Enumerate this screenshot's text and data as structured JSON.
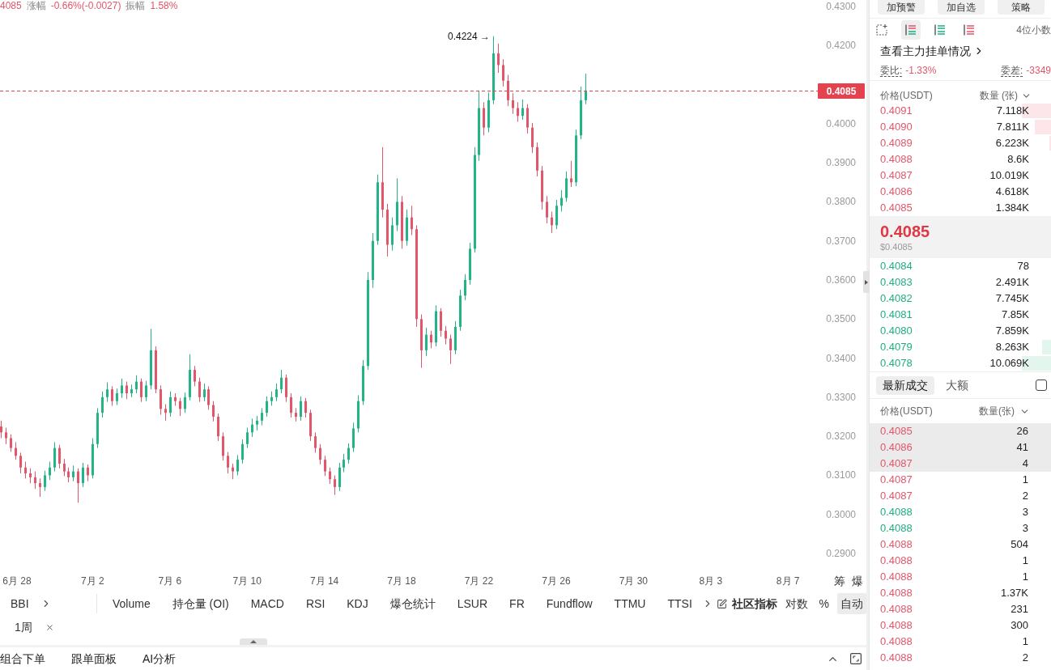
{
  "chart_header": {
    "last_price": "4085",
    "change_label": "涨幅",
    "change": "-0.66%(-0.0027)",
    "amplitude_label": "振幅",
    "amplitude": "1.58%"
  },
  "chart": {
    "chart_data": [
      {
        "type": "candlestick",
        "xlim": [
          "--06-27T05:00",
          "--08-08T13:00"
        ],
        "ylim": [
          0.29,
          0.43
        ],
        "xticks": [
          {
            "value": "--06-28",
            "label": "6月 28"
          },
          {
            "value": "--07-02",
            "label": "7月 2"
          },
          {
            "value": "--07-06",
            "label": "7月 6"
          },
          {
            "value": "--07-10",
            "label": "7月 10"
          },
          {
            "value": "--07-14",
            "label": "7月 14"
          },
          {
            "value": "--07-18",
            "label": "7月 18"
          },
          {
            "value": "--07-22",
            "label": "7月 22"
          },
          {
            "value": "--07-26",
            "label": "7月 26"
          },
          {
            "value": "--07-30",
            "label": "7月 30"
          },
          {
            "value": "--08-03",
            "label": "8月 3"
          },
          {
            "value": "--08-07",
            "label": "8月 7"
          }
        ],
        "yticks": [
          {
            "value": 0.43,
            "label": "0.4300"
          },
          {
            "value": 0.42,
            "label": "0.4200"
          },
          {
            "value": 0.4,
            "label": "0.4000"
          },
          {
            "value": 0.39,
            "label": "0.3900"
          },
          {
            "value": 0.38,
            "label": "0.3800"
          },
          {
            "value": 0.37,
            "label": "0.3700"
          },
          {
            "value": 0.36,
            "label": "0.3600"
          },
          {
            "value": 0.35,
            "label": "0.3500"
          },
          {
            "value": 0.34,
            "label": "0.3400"
          },
          {
            "value": 0.33,
            "label": "0.3300"
          },
          {
            "value": 0.32,
            "label": "0.3200"
          },
          {
            "value": 0.31,
            "label": "0.3100"
          },
          {
            "value": 0.3,
            "label": "0.3000"
          },
          {
            "value": 0.29,
            "label": "0.2900"
          }
        ],
        "ref_lines": [
          {
            "axis": "y",
            "value": 0.4085,
            "label": "0.4085",
            "color": "#e5424f",
            "line_style": "dashed"
          }
        ],
        "annotations": [
          "0.4224 →"
        ],
        "x": [
          "--06-27T06:00",
          "--06-27T12:00",
          "--06-27T18:00",
          "--06-28T00:00",
          "--06-28T06:00",
          "--06-28T12:00",
          "--06-28T18:00",
          "--06-29T00:00",
          "--06-29T06:00",
          "--06-29T12:00",
          "--06-29T18:00",
          "--06-30T00:00",
          "--06-30T06:00",
          "--06-30T12:00",
          "--06-30T18:00",
          "--07-01T00:00",
          "--07-01T06:00",
          "--07-01T12:00",
          "--07-01T18:00",
          "--07-02T00:00",
          "--07-02T06:00",
          "--07-02T12:00",
          "--07-02T18:00",
          "--07-03T00:00",
          "--07-03T06:00",
          "--07-03T12:00",
          "--07-03T18:00",
          "--07-04T00:00",
          "--07-04T06:00",
          "--07-04T12:00",
          "--07-04T18:00",
          "--07-05T00:00",
          "--07-05T06:00",
          "--07-05T12:00",
          "--07-05T18:00",
          "--07-06T00:00",
          "--07-06T06:00",
          "--07-06T12:00",
          "--07-06T18:00",
          "--07-07T00:00",
          "--07-07T06:00",
          "--07-07T12:00",
          "--07-07T18:00",
          "--07-08T00:00",
          "--07-08T06:00",
          "--07-08T12:00",
          "--07-08T18:00",
          "--07-09T00:00",
          "--07-09T06:00",
          "--07-09T12:00",
          "--07-09T18:00",
          "--07-10T00:00",
          "--07-10T06:00",
          "--07-10T12:00",
          "--07-10T18:00",
          "--07-11T00:00",
          "--07-11T06:00",
          "--07-11T12:00",
          "--07-11T18:00",
          "--07-12T00:00",
          "--07-12T06:00",
          "--07-12T12:00",
          "--07-12T18:00",
          "--07-13T00:00",
          "--07-13T06:00",
          "--07-13T12:00",
          "--07-13T18:00",
          "--07-14T00:00",
          "--07-14T06:00",
          "--07-14T12:00",
          "--07-14T18:00",
          "--07-15T00:00",
          "--07-15T06:00",
          "--07-15T12:00",
          "--07-15T18:00",
          "--07-16T00:00",
          "--07-16T06:00",
          "--07-16T12:00",
          "--07-16T18:00",
          "--07-17T00:00",
          "--07-17T06:00",
          "--07-17T12:00",
          "--07-17T18:00",
          "--07-18T00:00",
          "--07-18T06:00",
          "--07-18T12:00",
          "--07-18T18:00",
          "--07-19T00:00",
          "--07-19T06:00",
          "--07-19T12:00",
          "--07-19T18:00",
          "--07-20T00:00",
          "--07-20T06:00",
          "--07-20T12:00",
          "--07-20T18:00",
          "--07-21T00:00",
          "--07-21T06:00",
          "--07-21T12:00",
          "--07-21T18:00",
          "--07-22T00:00",
          "--07-22T06:00",
          "--07-22T12:00",
          "--07-22T18:00",
          "--07-23T00:00",
          "--07-23T06:00",
          "--07-23T12:00",
          "--07-23T18:00",
          "--07-24T00:00",
          "--07-24T06:00",
          "--07-24T12:00",
          "--07-24T18:00",
          "--07-25T00:00",
          "--07-25T06:00",
          "--07-25T12:00",
          "--07-25T18:00",
          "--07-26T00:00",
          "--07-26T06:00",
          "--07-26T12:00",
          "--07-26T18:00",
          "--07-27T00:00",
          "--07-27T06:00",
          "--07-27T12:00"
        ],
        "ohlc": [
          [
            0.3225,
            0.324,
            0.3195,
            0.321
          ],
          [
            0.321,
            0.3222,
            0.318,
            0.3195
          ],
          [
            0.3195,
            0.3205,
            0.316,
            0.317
          ],
          [
            0.317,
            0.3185,
            0.314,
            0.315
          ],
          [
            0.315,
            0.3158,
            0.3105,
            0.312
          ],
          [
            0.312,
            0.3135,
            0.3092,
            0.3105
          ],
          [
            0.3105,
            0.3118,
            0.308,
            0.3095
          ],
          [
            0.3095,
            0.311,
            0.3065,
            0.308
          ],
          [
            0.308,
            0.3092,
            0.3045,
            0.307
          ],
          [
            0.307,
            0.3112,
            0.306,
            0.31
          ],
          [
            0.31,
            0.3135,
            0.3088,
            0.312
          ],
          [
            0.312,
            0.3185,
            0.311,
            0.317
          ],
          [
            0.317,
            0.3178,
            0.3118,
            0.313
          ],
          [
            0.313,
            0.3142,
            0.3098,
            0.311
          ],
          [
            0.311,
            0.312,
            0.3082,
            0.3095
          ],
          [
            0.3095,
            0.3125,
            0.3085,
            0.311
          ],
          [
            0.311,
            0.3118,
            0.303,
            0.308
          ],
          [
            0.308,
            0.3132,
            0.307,
            0.312
          ],
          [
            0.312,
            0.3128,
            0.3085,
            0.31
          ],
          [
            0.31,
            0.3195,
            0.3092,
            0.318
          ],
          [
            0.318,
            0.3272,
            0.317,
            0.326
          ],
          [
            0.326,
            0.3315,
            0.3248,
            0.33
          ],
          [
            0.33,
            0.3338,
            0.3288,
            0.332
          ],
          [
            0.332,
            0.3328,
            0.3278,
            0.329
          ],
          [
            0.329,
            0.3322,
            0.328,
            0.331
          ],
          [
            0.331,
            0.3348,
            0.3298,
            0.333
          ],
          [
            0.333,
            0.334,
            0.3295,
            0.331
          ],
          [
            0.331,
            0.3332,
            0.33,
            0.332
          ],
          [
            0.332,
            0.3356,
            0.331,
            0.334
          ],
          [
            0.334,
            0.3348,
            0.3288,
            0.33
          ],
          [
            0.33,
            0.3342,
            0.329,
            0.333
          ],
          [
            0.333,
            0.3475,
            0.332,
            0.342
          ],
          [
            0.342,
            0.343,
            0.331,
            0.332
          ],
          [
            0.332,
            0.333,
            0.3255,
            0.327
          ],
          [
            0.327,
            0.3282,
            0.324,
            0.326
          ],
          [
            0.326,
            0.3315,
            0.325,
            0.33
          ],
          [
            0.33,
            0.331,
            0.3278,
            0.329
          ],
          [
            0.329,
            0.3298,
            0.3252,
            0.327
          ],
          [
            0.327,
            0.3312,
            0.326,
            0.33
          ],
          [
            0.33,
            0.341,
            0.3292,
            0.337
          ],
          [
            0.337,
            0.338,
            0.3328,
            0.334
          ],
          [
            0.334,
            0.335,
            0.3288,
            0.33
          ],
          [
            0.33,
            0.3335,
            0.329,
            0.332
          ],
          [
            0.332,
            0.3328,
            0.3268,
            0.328
          ],
          [
            0.328,
            0.329,
            0.3238,
            0.325
          ],
          [
            0.325,
            0.3258,
            0.3188,
            0.32
          ],
          [
            0.32,
            0.321,
            0.3138,
            0.315
          ],
          [
            0.315,
            0.316,
            0.3105,
            0.312
          ],
          [
            0.312,
            0.313,
            0.309,
            0.311
          ],
          [
            0.311,
            0.3152,
            0.31,
            0.314
          ],
          [
            0.314,
            0.3192,
            0.313,
            0.318
          ],
          [
            0.318,
            0.3222,
            0.317,
            0.321
          ],
          [
            0.321,
            0.3245,
            0.3198,
            0.323
          ],
          [
            0.323,
            0.3252,
            0.3215,
            0.324
          ],
          [
            0.324,
            0.3272,
            0.3228,
            0.326
          ],
          [
            0.326,
            0.3302,
            0.325,
            0.329
          ],
          [
            0.329,
            0.3315,
            0.3278,
            0.33
          ],
          [
            0.33,
            0.3335,
            0.329,
            0.332
          ],
          [
            0.332,
            0.337,
            0.331,
            0.335
          ],
          [
            0.335,
            0.3358,
            0.3288,
            0.33
          ],
          [
            0.33,
            0.331,
            0.3248,
            0.326
          ],
          [
            0.326,
            0.3272,
            0.3238,
            0.325
          ],
          [
            0.325,
            0.3302,
            0.324,
            0.329
          ],
          [
            0.329,
            0.3298,
            0.3248,
            0.326
          ],
          [
            0.326,
            0.3268,
            0.3188,
            0.32
          ],
          [
            0.32,
            0.321,
            0.3158,
            0.317
          ],
          [
            0.317,
            0.318,
            0.3128,
            0.314
          ],
          [
            0.314,
            0.315,
            0.3098,
            0.311
          ],
          [
            0.311,
            0.312,
            0.3078,
            0.309
          ],
          [
            0.309,
            0.31,
            0.305,
            0.307
          ],
          [
            0.307,
            0.3132,
            0.306,
            0.312
          ],
          [
            0.312,
            0.3155,
            0.3108,
            0.314
          ],
          [
            0.314,
            0.3182,
            0.313,
            0.317
          ],
          [
            0.317,
            0.3235,
            0.316,
            0.322
          ],
          [
            0.322,
            0.3305,
            0.321,
            0.329
          ],
          [
            0.329,
            0.3395,
            0.328,
            0.338
          ],
          [
            0.338,
            0.362,
            0.337,
            0.36
          ],
          [
            0.36,
            0.372,
            0.358,
            0.37
          ],
          [
            0.37,
            0.387,
            0.369,
            0.385
          ],
          [
            0.385,
            0.394,
            0.376,
            0.378
          ],
          [
            0.378,
            0.3795,
            0.366,
            0.369
          ],
          [
            0.369,
            0.376,
            0.3675,
            0.374
          ],
          [
            0.374,
            0.386,
            0.3725,
            0.38
          ],
          [
            0.38,
            0.3815,
            0.368,
            0.37
          ],
          [
            0.37,
            0.378,
            0.3688,
            0.376
          ],
          [
            0.376,
            0.379,
            0.3715,
            0.373
          ],
          [
            0.373,
            0.374,
            0.348,
            0.35
          ],
          [
            0.35,
            0.3512,
            0.3375,
            0.342
          ],
          [
            0.342,
            0.3478,
            0.3405,
            0.346
          ],
          [
            0.346,
            0.347,
            0.3425,
            0.344
          ],
          [
            0.344,
            0.3535,
            0.343,
            0.352
          ],
          [
            0.352,
            0.3528,
            0.3455,
            0.347
          ],
          [
            0.347,
            0.3482,
            0.3435,
            0.345
          ],
          [
            0.345,
            0.346,
            0.3385,
            0.342
          ],
          [
            0.342,
            0.3495,
            0.341,
            0.348
          ],
          [
            0.348,
            0.3575,
            0.347,
            0.356
          ],
          [
            0.356,
            0.3615,
            0.3548,
            0.36
          ],
          [
            0.36,
            0.3695,
            0.3588,
            0.368
          ],
          [
            0.368,
            0.394,
            0.367,
            0.392
          ],
          [
            0.392,
            0.4085,
            0.3905,
            0.404
          ],
          [
            0.404,
            0.4055,
            0.397,
            0.399
          ],
          [
            0.399,
            0.408,
            0.3978,
            0.406
          ],
          [
            0.406,
            0.4224,
            0.405,
            0.418
          ],
          [
            0.418,
            0.4205,
            0.413,
            0.415
          ],
          [
            0.415,
            0.4165,
            0.4095,
            0.411
          ],
          [
            0.411,
            0.4125,
            0.4045,
            0.406
          ],
          [
            0.406,
            0.4078,
            0.4025,
            0.404
          ],
          [
            0.404,
            0.4055,
            0.4005,
            0.402
          ],
          [
            0.402,
            0.4062,
            0.401,
            0.404
          ],
          [
            0.404,
            0.405,
            0.3975,
            0.399
          ],
          [
            0.399,
            0.4002,
            0.3925,
            0.394
          ],
          [
            0.394,
            0.3952,
            0.3865,
            0.388
          ],
          [
            0.388,
            0.3892,
            0.378,
            0.38
          ],
          [
            0.38,
            0.3815,
            0.3745,
            0.376
          ],
          [
            0.376,
            0.3775,
            0.372,
            0.374
          ],
          [
            0.374,
            0.3805,
            0.373,
            0.379
          ],
          [
            0.379,
            0.383,
            0.3775,
            0.381
          ],
          [
            0.381,
            0.3878,
            0.38,
            0.386
          ],
          [
            0.386,
            0.3905,
            0.3838,
            0.385
          ],
          [
            0.385,
            0.3985,
            0.384,
            0.397
          ],
          [
            0.397,
            0.4095,
            0.396,
            0.406
          ],
          [
            0.406,
            0.4128,
            0.405,
            0.4085
          ]
        ]
      }
    ],
    "axis_buttons": [
      "筹",
      "爆"
    ]
  },
  "indicator_bar": {
    "main": [
      {
        "label": "BBI"
      }
    ],
    "sub": [
      "Volume",
      "持仓量 (OI)",
      "MACD",
      "RSI",
      "KDJ",
      "爆仓统计",
      "LSUR",
      "FR",
      "Fundflow",
      "TTMU",
      "TTSI"
    ],
    "community": "社区指标",
    "scale_options": [
      {
        "label": "对数",
        "selected": false
      },
      {
        "label": "%",
        "selected": false
      },
      {
        "label": "自动",
        "selected": true
      }
    ]
  },
  "active_indicators": [
    {
      "label": "1周"
    }
  ],
  "bottom_tabs": [
    "组合下单",
    "跟单面板",
    "AI分析"
  ],
  "side_panel": {
    "top_buttons": [
      "加预警",
      "加自选",
      "策略"
    ],
    "view_modes": [
      {
        "kind": "both",
        "selected": true
      },
      {
        "kind": "bids",
        "selected": false
      },
      {
        "kind": "asks",
        "selected": false
      }
    ],
    "precision": "4位小数",
    "whale_orders_link": "查看主力挂单情况",
    "ratio_label": "委比:",
    "ratio": "-1.33%",
    "diff_label": "委差:",
    "diff": "-3349",
    "order_book": {
      "columns": [
        "价格(USDT)",
        "数量 (张)"
      ],
      "asks": [
        {
          "price": "0.4091",
          "amount": "7.118K",
          "level": 0.16
        },
        {
          "price": "0.4090",
          "amount": "7.811K",
          "level": 0.09
        },
        {
          "price": "0.4089",
          "amount": "6.223K",
          "level": 0.01
        },
        {
          "price": "0.4088",
          "amount": "8.6K"
        },
        {
          "price": "0.4087",
          "amount": "10.019K"
        },
        {
          "price": "0.4086",
          "amount": "4.618K"
        },
        {
          "price": "0.4085",
          "amount": "1.384K"
        }
      ],
      "last_price": "0.4085",
      "last_price_usd": "$0.4085",
      "bids": [
        {
          "price": "0.4084",
          "amount": "78"
        },
        {
          "price": "0.4083",
          "amount": "2.491K"
        },
        {
          "price": "0.4082",
          "amount": "7.745K"
        },
        {
          "price": "0.4081",
          "amount": "7.85K"
        },
        {
          "price": "0.4080",
          "amount": "7.859K"
        },
        {
          "price": "0.4079",
          "amount": "8.263K",
          "level": 0.05
        },
        {
          "price": "0.4078",
          "amount": "10.069K",
          "level": 0.16
        }
      ]
    },
    "trade_tabs": [
      {
        "label": "最新成交",
        "selected": true
      },
      {
        "label": "大额",
        "selected": false
      }
    ],
    "trade_filter": {
      "checked": false
    },
    "trades": {
      "columns": [
        "价格(USDT)",
        "数量(张)"
      ],
      "rows": [
        {
          "price": "0.4085",
          "amount": "26",
          "color": "#e2566a",
          "highlighted": true
        },
        {
          "price": "0.4086",
          "amount": "41",
          "color": "#e2566a",
          "highlighted": true
        },
        {
          "price": "0.4087",
          "amount": "4",
          "color": "#e2566a",
          "highlighted": true
        },
        {
          "price": "0.4087",
          "amount": "1",
          "color": "#e2566a",
          "highlighted": false
        },
        {
          "price": "0.4087",
          "amount": "2",
          "color": "#e2566a",
          "highlighted": false
        },
        {
          "price": "0.4088",
          "amount": "3",
          "color": "#1fae84",
          "highlighted": false
        },
        {
          "price": "0.4088",
          "amount": "3",
          "color": "#1fae84",
          "highlighted": false
        },
        {
          "price": "0.4088",
          "amount": "504",
          "color": "#e2566a",
          "highlighted": false
        },
        {
          "price": "0.4088",
          "amount": "1",
          "color": "#e2566a",
          "highlighted": false
        },
        {
          "price": "0.4088",
          "amount": "1",
          "color": "#e2566a",
          "highlighted": false
        },
        {
          "price": "0.4088",
          "amount": "1.37K",
          "color": "#e2566a",
          "highlighted": false
        },
        {
          "price": "0.4088",
          "amount": "231",
          "color": "#e2566a",
          "highlighted": false
        },
        {
          "price": "0.4088",
          "amount": "300",
          "color": "#e2566a",
          "highlighted": false
        },
        {
          "price": "0.4088",
          "amount": "1",
          "color": "#e2566a",
          "highlighted": false
        },
        {
          "price": "0.4088",
          "amount": "2",
          "color": "#e2566a",
          "highlighted": false
        }
      ]
    }
  }
}
